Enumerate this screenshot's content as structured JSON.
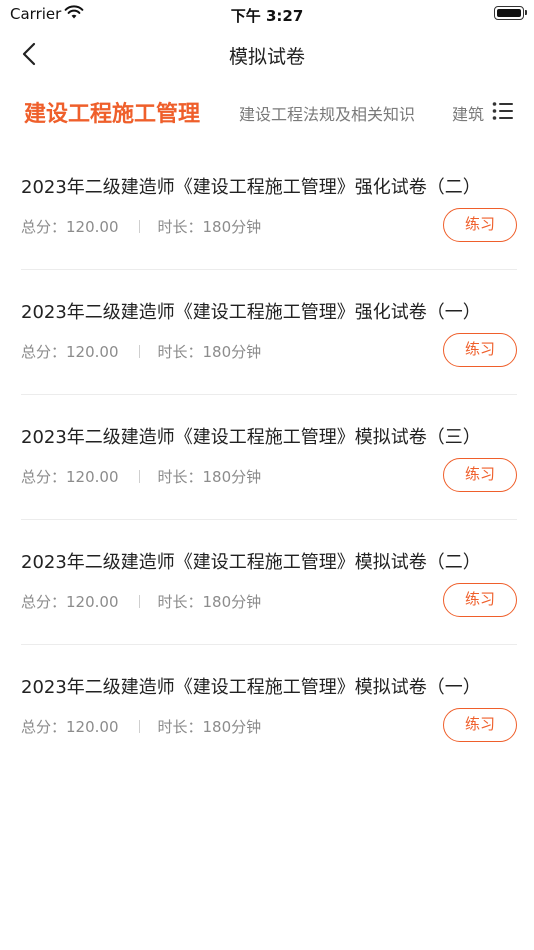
{
  "status_bar": {
    "carrier": "Carrier",
    "time": "下午 3:27",
    "battery_level": 1.0
  },
  "nav": {
    "title": "模拟试卷",
    "back_icon": "chevron-left-icon"
  },
  "tabs": [
    {
      "label": "建设工程施工管理",
      "active": true
    },
    {
      "label": "建设工程法规及相关知识",
      "active": false
    },
    {
      "label": "建筑",
      "active": false
    }
  ],
  "menu_icon": "list-menu-icon",
  "colors": {
    "accent": "#ef5f2b",
    "muted": "#8c8c8c",
    "text": "#222222",
    "divider": "#ececec"
  },
  "papers": [
    {
      "title": "2023年二级建造师《建设工程施工管理》强化试卷（二）",
      "score": "总分：120.00",
      "duration": "时长：180分钟",
      "action": "练习"
    },
    {
      "title": "2023年二级建造师《建设工程施工管理》强化试卷（一）",
      "score": "总分：120.00",
      "duration": "时长：180分钟",
      "action": "练习"
    },
    {
      "title": "2023年二级建造师《建设工程施工管理》模拟试卷（三）",
      "score": "总分：120.00",
      "duration": "时长：180分钟",
      "action": "练习"
    },
    {
      "title": "2023年二级建造师《建设工程施工管理》模拟试卷（二）",
      "score": "总分：120.00",
      "duration": "时长：180分钟",
      "action": "练习"
    },
    {
      "title": "2023年二级建造师《建设工程施工管理》模拟试卷（一）",
      "score": "总分：120.00",
      "duration": "时长：180分钟",
      "action": "练习"
    }
  ]
}
